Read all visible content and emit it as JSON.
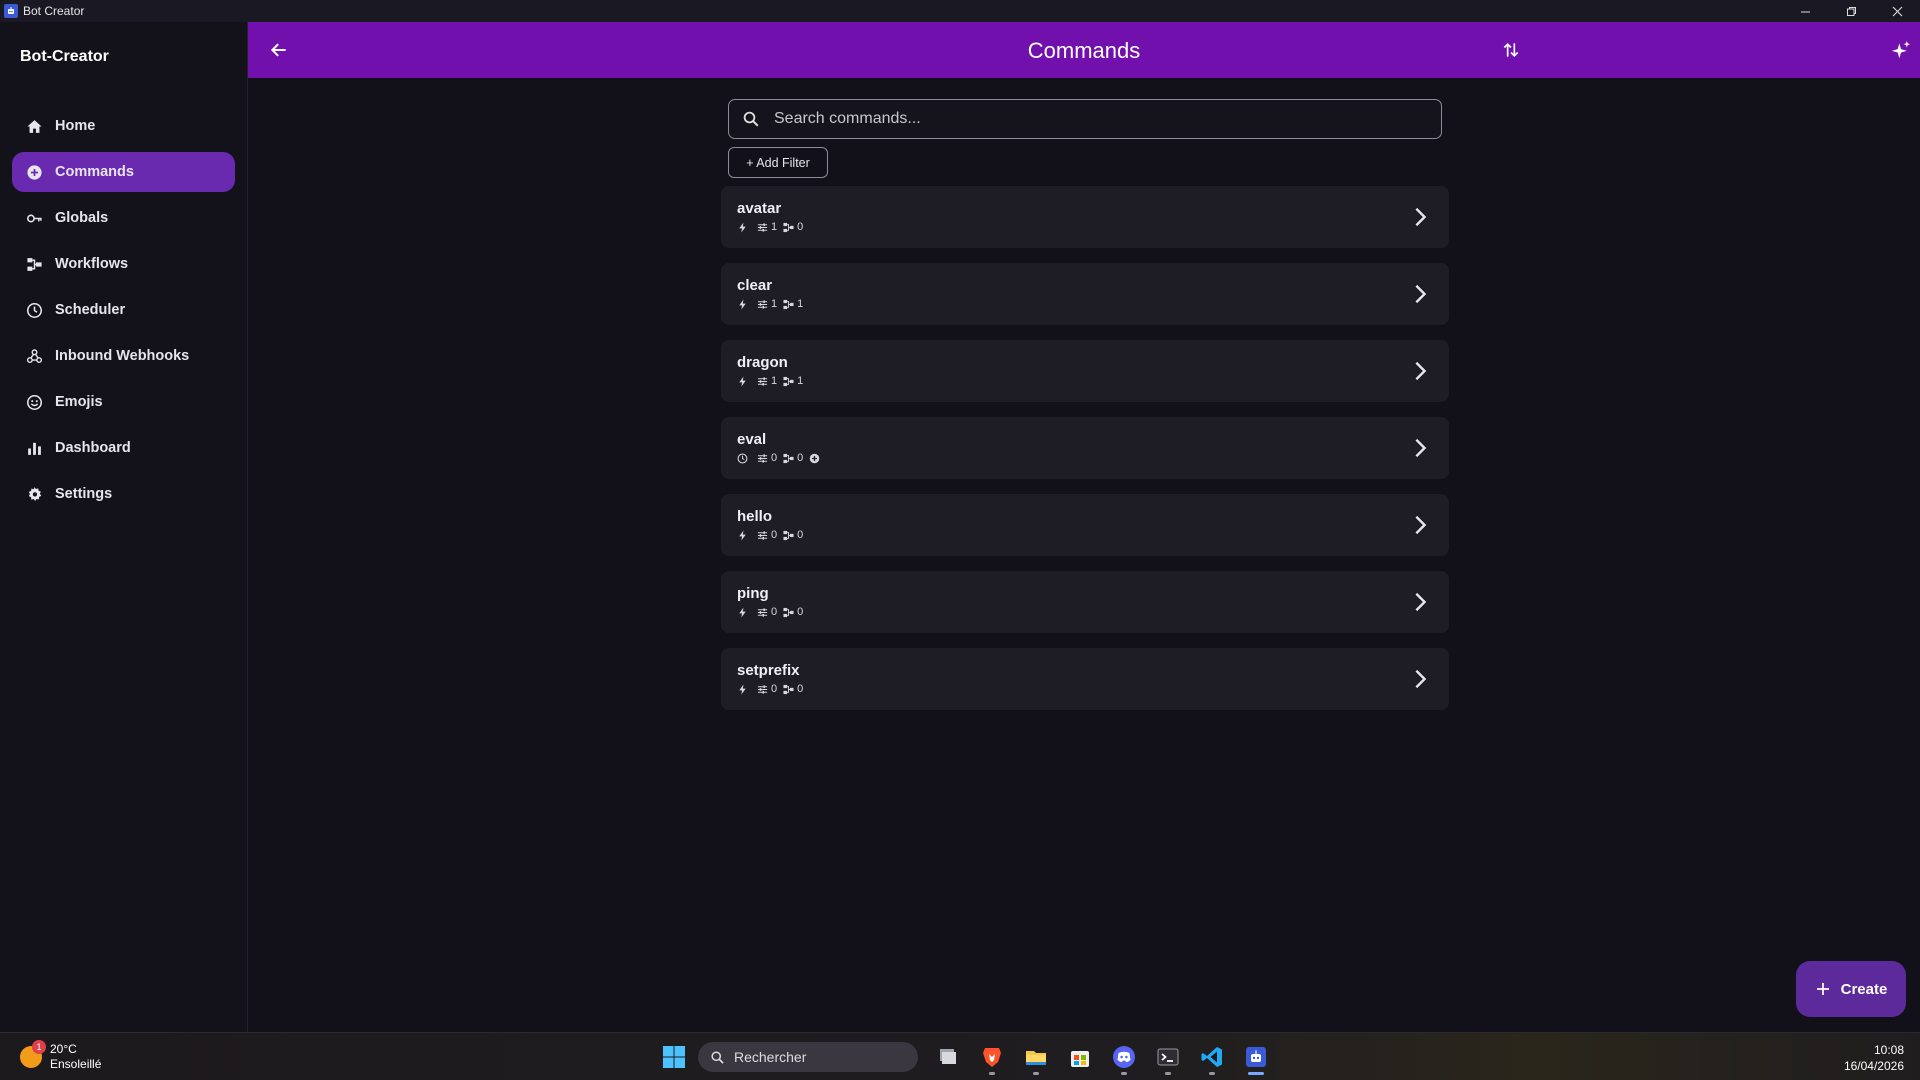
{
  "window": {
    "title": "Bot Creator"
  },
  "sidebar": {
    "brand": "Bot-Creator",
    "items": [
      {
        "label": "Home",
        "icon": "home-icon"
      },
      {
        "label": "Commands",
        "icon": "plus-circle-icon",
        "active": true
      },
      {
        "label": "Globals",
        "icon": "key-icon"
      },
      {
        "label": "Workflows",
        "icon": "workflow-icon"
      },
      {
        "label": "Scheduler",
        "icon": "clock-icon"
      },
      {
        "label": "Inbound Webhooks",
        "icon": "webhook-icon"
      },
      {
        "label": "Emojis",
        "icon": "smiley-icon"
      },
      {
        "label": "Dashboard",
        "icon": "bar-chart-icon"
      },
      {
        "label": "Settings",
        "icon": "gear-icon"
      }
    ]
  },
  "header": {
    "title": "Commands"
  },
  "search": {
    "placeholder": "Search commands..."
  },
  "filter": {
    "add_label": "+ Add Filter"
  },
  "commands": [
    {
      "name": "avatar",
      "trigger": "bolt-icon",
      "options": "1",
      "actions": "0",
      "extra": false
    },
    {
      "name": "clear",
      "trigger": "bolt-icon",
      "options": "1",
      "actions": "1",
      "extra": false
    },
    {
      "name": "dragon",
      "trigger": "bolt-icon",
      "options": "1",
      "actions": "1",
      "extra": false
    },
    {
      "name": "eval",
      "trigger": "clock-icon",
      "options": "0",
      "actions": "0",
      "extra": true
    },
    {
      "name": "hello",
      "trigger": "bolt-icon",
      "options": "0",
      "actions": "0",
      "extra": false
    },
    {
      "name": "ping",
      "trigger": "bolt-icon",
      "options": "0",
      "actions": "0",
      "extra": false
    },
    {
      "name": "setprefix",
      "trigger": "bolt-icon",
      "options": "0",
      "actions": "0",
      "extra": false
    }
  ],
  "create_button": {
    "label": "Create"
  },
  "taskbar": {
    "temperature": "20°C",
    "condition": "Ensoleillé",
    "weather_badge": "1",
    "search_label": "Rechercher",
    "time": "10:08",
    "date": "16/04/2026"
  },
  "colors": {
    "accent": "#7210ad",
    "active_nav": "#6a2ab0",
    "create_button": "#5d2a9c"
  }
}
